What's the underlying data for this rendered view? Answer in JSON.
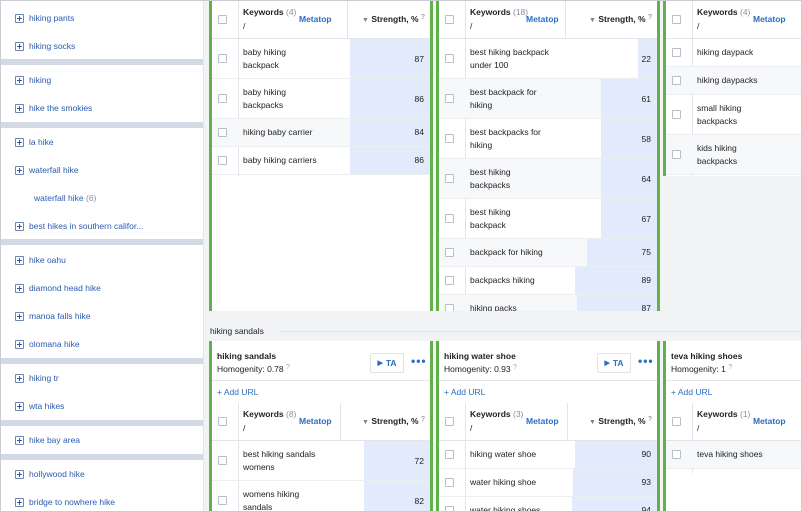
{
  "sidebar": {
    "items": [
      {
        "label": "hiking pants"
      },
      {
        "label": "hiking socks"
      },
      {
        "label": "hiking"
      },
      {
        "label": "hike the smokies"
      },
      {
        "label": "la hike"
      },
      {
        "label": "waterfall hike"
      },
      {
        "label": "waterfall hike",
        "count": "(6)"
      },
      {
        "label": "best hikes in southern califor..."
      },
      {
        "label": "hike oahu"
      },
      {
        "label": "diamond head hike"
      },
      {
        "label": "manoa falls hike"
      },
      {
        "label": "olomana hike"
      },
      {
        "label": "hiking tr"
      },
      {
        "label": "wta hikes"
      },
      {
        "label": "hike bay area"
      },
      {
        "label": "hollywood hike"
      },
      {
        "label": "bridge to nowhere hike"
      }
    ]
  },
  "table_header": {
    "keywords_label": "Keywords",
    "slash": "/",
    "metatop": "Metatop",
    "strength_label": "Strength, %",
    "help_mark": "?"
  },
  "top_clusters": [
    {
      "count": "(4)",
      "rows": [
        {
          "keyword": "baby hiking backpack",
          "strength": 87
        },
        {
          "keyword": "baby hiking backpacks",
          "strength": 86
        },
        {
          "keyword": "hiking baby carrier",
          "strength": 84
        },
        {
          "keyword": "baby hiking carriers",
          "strength": 86
        }
      ]
    },
    {
      "count": "(18)",
      "rows": [
        {
          "keyword": "best hiking backpack under 100",
          "strength": 22
        },
        {
          "keyword": "best backpack for hiking",
          "strength": 61
        },
        {
          "keyword": "best backpacks for hiking",
          "strength": 58
        },
        {
          "keyword": "best hiking backpacks",
          "strength": 64
        },
        {
          "keyword": "best hiking backpack",
          "strength": 67
        },
        {
          "keyword": "backpack for hiking",
          "strength": 75
        },
        {
          "keyword": "backpacks hiking",
          "strength": 89
        },
        {
          "keyword": "hiking packs",
          "strength": 87
        }
      ]
    },
    {
      "count": "(4)",
      "rows": [
        {
          "keyword": "hiking daypack"
        },
        {
          "keyword": "hiking daypacks"
        },
        {
          "keyword": "small hiking backpacks"
        },
        {
          "keyword": "kids hiking backpacks"
        }
      ]
    }
  ],
  "group": {
    "label": "hiking sandals"
  },
  "bottom_clusters": [
    {
      "title": "hiking sandals",
      "homogeneity": "Homogenity: 0.78",
      "ta_label": "TA",
      "dots": "•••",
      "add_url": "+ Add URL",
      "count": "(8)",
      "rows": [
        {
          "keyword": "best hiking sandals womens",
          "strength": 72
        },
        {
          "keyword": "womens hiking sandals",
          "strength": 82
        }
      ]
    },
    {
      "title": "hiking water shoe",
      "homogeneity": "Homogenity: 0.93",
      "ta_label": "TA",
      "dots": "•••",
      "add_url": "+ Add URL",
      "count": "(3)",
      "rows": [
        {
          "keyword": "hiking water shoe",
          "strength": 90
        },
        {
          "keyword": "water hiking shoe",
          "strength": 93
        },
        {
          "keyword": "water hiking shoes",
          "strength": 94
        }
      ]
    },
    {
      "title": "teva hiking shoes",
      "homogeneity": "Homogenity: 1",
      "add_url": "+ Add URL",
      "count": "(1)",
      "rows": [
        {
          "keyword": "teva hiking shoes"
        }
      ]
    }
  ],
  "colors": {
    "accent": "#2a6dc4",
    "green": "#62b04a",
    "bar": "#e1ebfb"
  }
}
